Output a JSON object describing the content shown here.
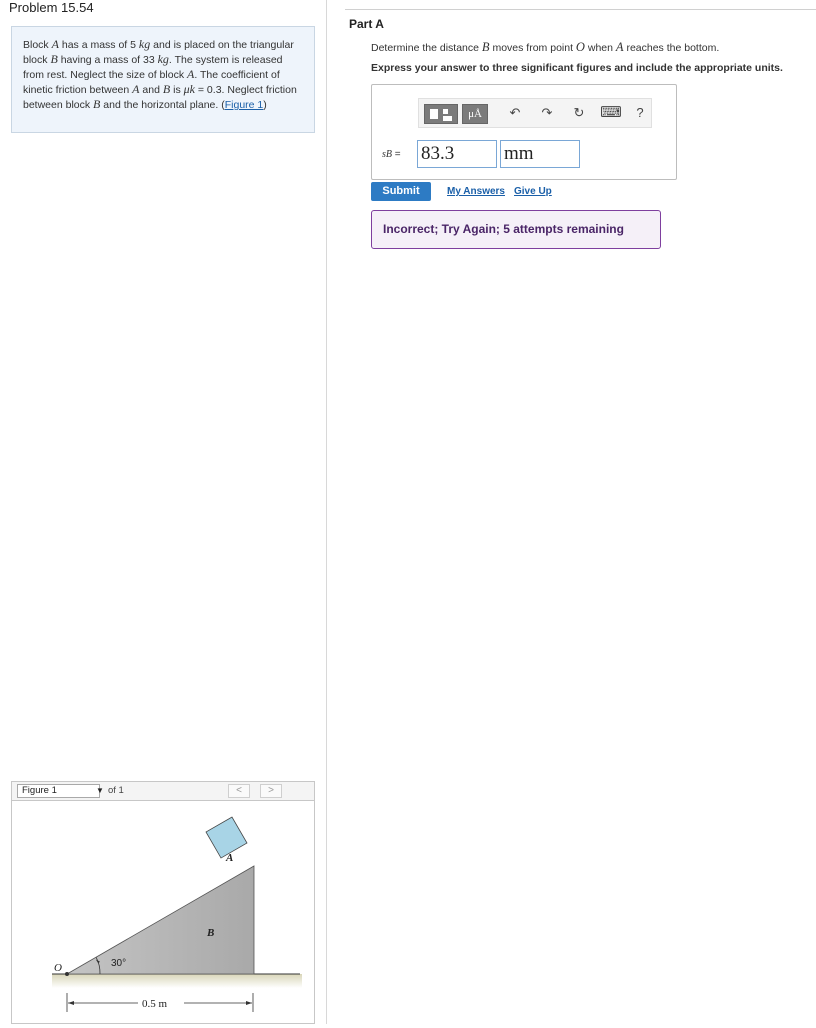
{
  "problem": {
    "title": "Problem 15.54",
    "text_parts": {
      "p1": "Block ",
      "A": "A",
      "p2": " has a mass of 5 ",
      "kg1": "kg",
      "p3": " and is placed on the triangular block ",
      "B": "B",
      "p4": " having a mass of 33 ",
      "kg2": "kg",
      "p5": ". The system is released from rest. Neglect the size of block ",
      "A2": "A",
      "p6": ". The coefficient of kinetic friction between ",
      "A3": "A",
      "p7": " and ",
      "B2": "B",
      "p8": " is ",
      "mu": "μk",
      "p9": " = 0.3. Neglect friction between block ",
      "B3": "B",
      "p10": " and the horizontal plane. (",
      "figure_link": "Figure 1",
      "p11": ")"
    }
  },
  "figure_nav": {
    "selected": "Figure 1",
    "of_label": "of 1",
    "prev": "<",
    "next": ">"
  },
  "figure": {
    "label_O": "O",
    "label_A": "A",
    "label_B": "B",
    "angle_label": "30°",
    "dimension_label": "0.5 m",
    "colors": {
      "block_b": "#b4b4b4",
      "block_a": "#a8d4e6",
      "ground": "#d9d6b8"
    }
  },
  "part": {
    "title": "Part A",
    "q1": "Determine the distance ",
    "qB": "B",
    "q2": " moves from point ",
    "qO": "O",
    "q3": " when ",
    "qA": "A",
    "q4": " reaches the bottom.",
    "instruction": "Express your answer to three significant figures and include the appropriate units."
  },
  "toolbar": {
    "units_label": "μÅ",
    "undo_icon": "↶",
    "redo_icon": "↷",
    "reset_icon": "↻",
    "keyboard_icon": "⌨",
    "help_label": "?"
  },
  "answer": {
    "label_var": "sB",
    "label_eq": " =",
    "value": "83.3",
    "unit": "mm"
  },
  "actions": {
    "submit": "Submit",
    "my_answers": "My Answers",
    "give_up": "Give Up"
  },
  "feedback": {
    "text": "Incorrect; Try Again; 5 attempts remaining",
    "color": "#7e3f9e"
  }
}
